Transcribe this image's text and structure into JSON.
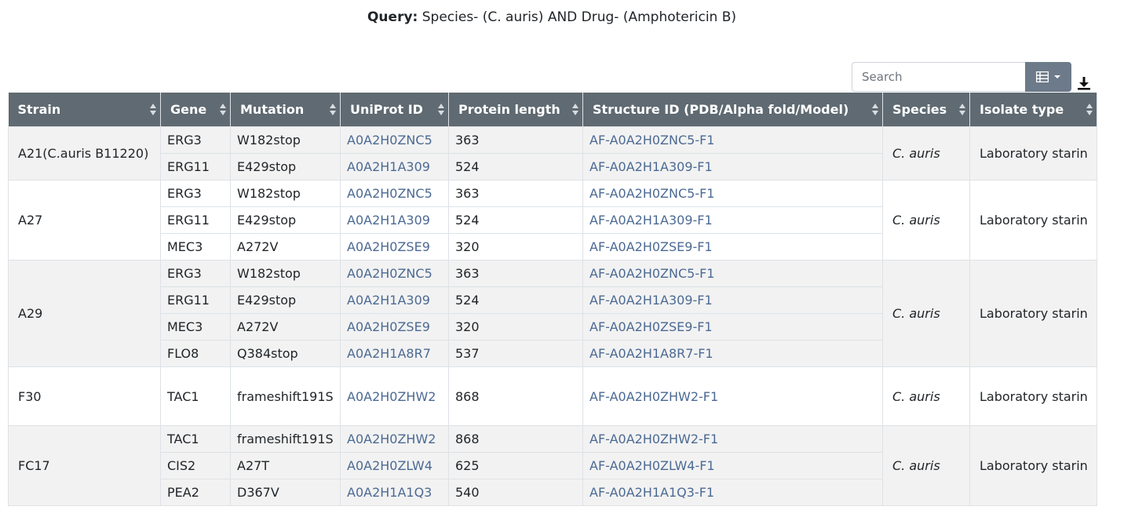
{
  "query": {
    "label": "Query:",
    "text": "Species- (C. auris) AND Drug- (Amphotericin B)"
  },
  "toolbar": {
    "search_placeholder": "Search",
    "columns_icon": "list-icon",
    "download_icon": "download-icon"
  },
  "colors": {
    "header_bg": "#5f6a72",
    "link": "#4c6a93",
    "button_bg": "#6c7a89",
    "stripe": "#f2f2f2"
  },
  "table": {
    "headers": [
      "Strain",
      "Gene",
      "Mutation",
      "UniProt ID",
      "Protein length",
      "Structure ID (PDB/Alpha fold/Model)",
      "Species",
      "Isolate type"
    ],
    "groups": [
      {
        "strain": "A21(C.auris B11220)",
        "species": "C. auris",
        "isolate": "Laboratory starin",
        "rows": [
          {
            "gene": "ERG3",
            "mutation": "W182stop",
            "uniprot": "A0A2H0ZNC5",
            "length": "363",
            "structure": "AF-A0A2H0ZNC5-F1"
          },
          {
            "gene": "ERG11",
            "mutation": "E429stop",
            "uniprot": "A0A2H1A309",
            "length": "524",
            "structure": "AF-A0A2H1A309-F1"
          }
        ]
      },
      {
        "strain": "A27",
        "species": "C. auris",
        "isolate": "Laboratory starin",
        "rows": [
          {
            "gene": "ERG3",
            "mutation": "W182stop",
            "uniprot": "A0A2H0ZNC5",
            "length": "363",
            "structure": "AF-A0A2H0ZNC5-F1"
          },
          {
            "gene": "ERG11",
            "mutation": "E429stop",
            "uniprot": "A0A2H1A309",
            "length": "524",
            "structure": "AF-A0A2H1A309-F1"
          },
          {
            "gene": "MEC3",
            "mutation": "A272V",
            "uniprot": "A0A2H0ZSE9",
            "length": "320",
            "structure": "AF-A0A2H0ZSE9-F1"
          }
        ]
      },
      {
        "strain": "A29",
        "species": "C. auris",
        "isolate": "Laboratory starin",
        "rows": [
          {
            "gene": "ERG3",
            "mutation": "W182stop",
            "uniprot": "A0A2H0ZNC5",
            "length": "363",
            "structure": "AF-A0A2H0ZNC5-F1"
          },
          {
            "gene": "ERG11",
            "mutation": "E429stop",
            "uniprot": "A0A2H1A309",
            "length": "524",
            "structure": "AF-A0A2H1A309-F1"
          },
          {
            "gene": "MEC3",
            "mutation": "A272V",
            "uniprot": "A0A2H0ZSE9",
            "length": "320",
            "structure": "AF-A0A2H0ZSE9-F1"
          },
          {
            "gene": "FLO8",
            "mutation": "Q384stop",
            "uniprot": "A0A2H1A8R7",
            "length": "537",
            "structure": "AF-A0A2H1A8R7-F1"
          }
        ]
      },
      {
        "strain": "F30",
        "species": "C. auris",
        "isolate": "Laboratory starin",
        "rows": [
          {
            "gene": "TAC1",
            "mutation": "frameshift191S",
            "uniprot": "A0A2H0ZHW2",
            "length": "868",
            "structure": "AF-A0A2H0ZHW2-F1"
          }
        ]
      },
      {
        "strain": "FC17",
        "species": "C. auris",
        "isolate": "Laboratory starin",
        "rows": [
          {
            "gene": "TAC1",
            "mutation": "frameshift191S",
            "uniprot": "A0A2H0ZHW2",
            "length": "868",
            "structure": "AF-A0A2H0ZHW2-F1"
          },
          {
            "gene": "CIS2",
            "mutation": "A27T",
            "uniprot": "A0A2H0ZLW4",
            "length": "625",
            "structure": "AF-A0A2H0ZLW4-F1"
          },
          {
            "gene": "PEA2",
            "mutation": "D367V",
            "uniprot": "A0A2H1A1Q3",
            "length": "540",
            "structure": "AF-A0A2H1A1Q3-F1"
          }
        ]
      }
    ]
  }
}
